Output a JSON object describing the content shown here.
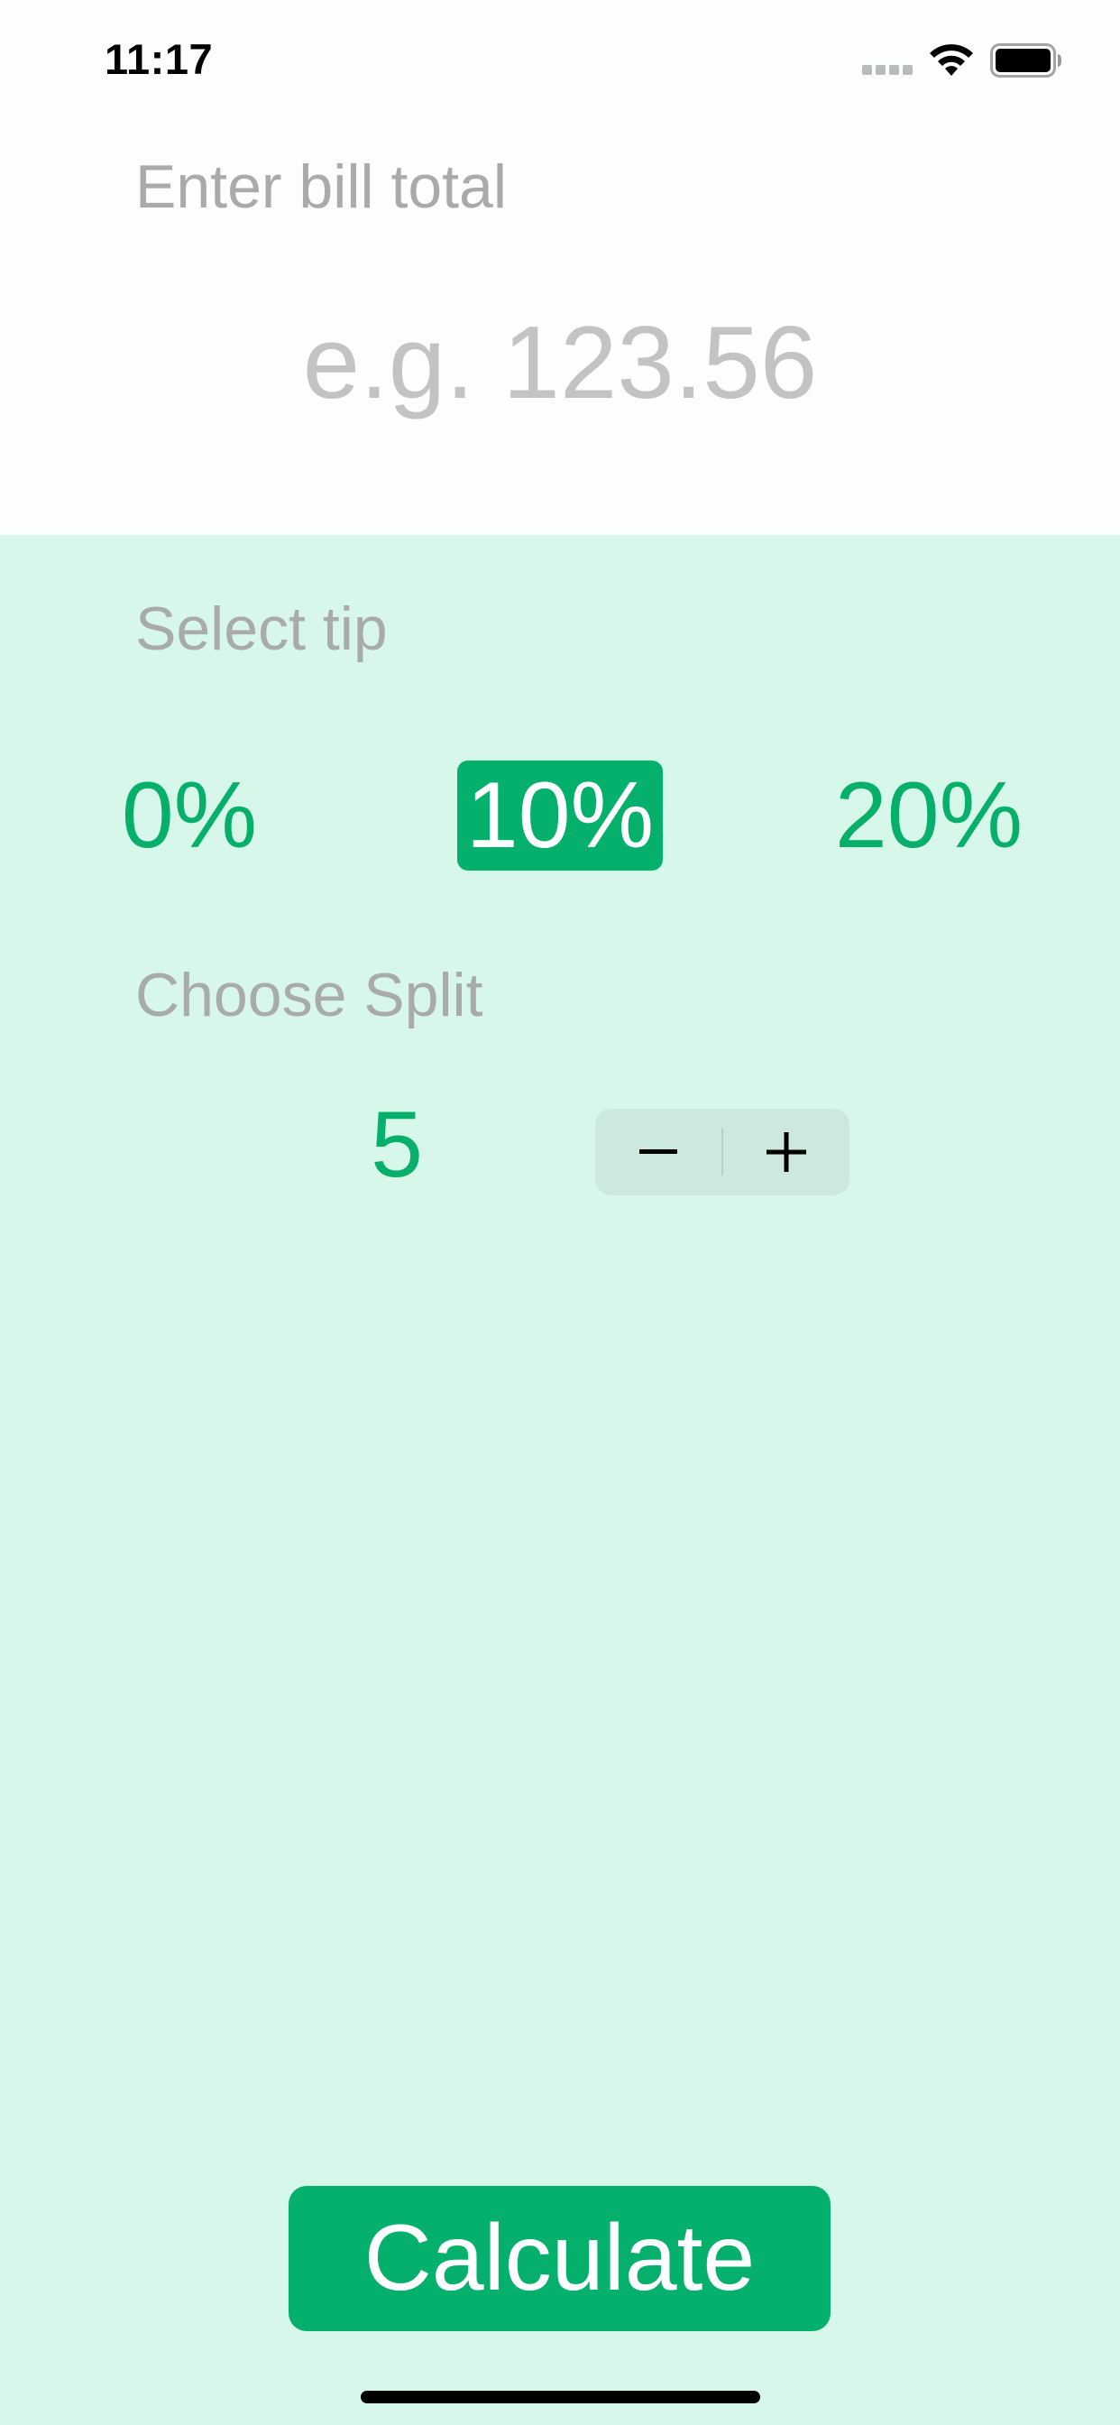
{
  "status_bar": {
    "time": "11:17",
    "icons": [
      "signal-icon",
      "wifi-icon",
      "battery-icon"
    ]
  },
  "bill": {
    "label": "Enter bill total",
    "placeholder": "e.g. 123.56",
    "value": ""
  },
  "tip": {
    "label": "Select tip",
    "options": [
      "0%",
      "10%",
      "20%"
    ],
    "selected": "10%"
  },
  "split": {
    "label": "Choose Split",
    "value": "5"
  },
  "calculate_label": "Calculate",
  "colors": {
    "accent": "#04b06b",
    "background": "#d7f7ea",
    "top_background": "#fbfefd",
    "label_text": "#a8abaa",
    "stepper_background": "#cde8dd"
  }
}
